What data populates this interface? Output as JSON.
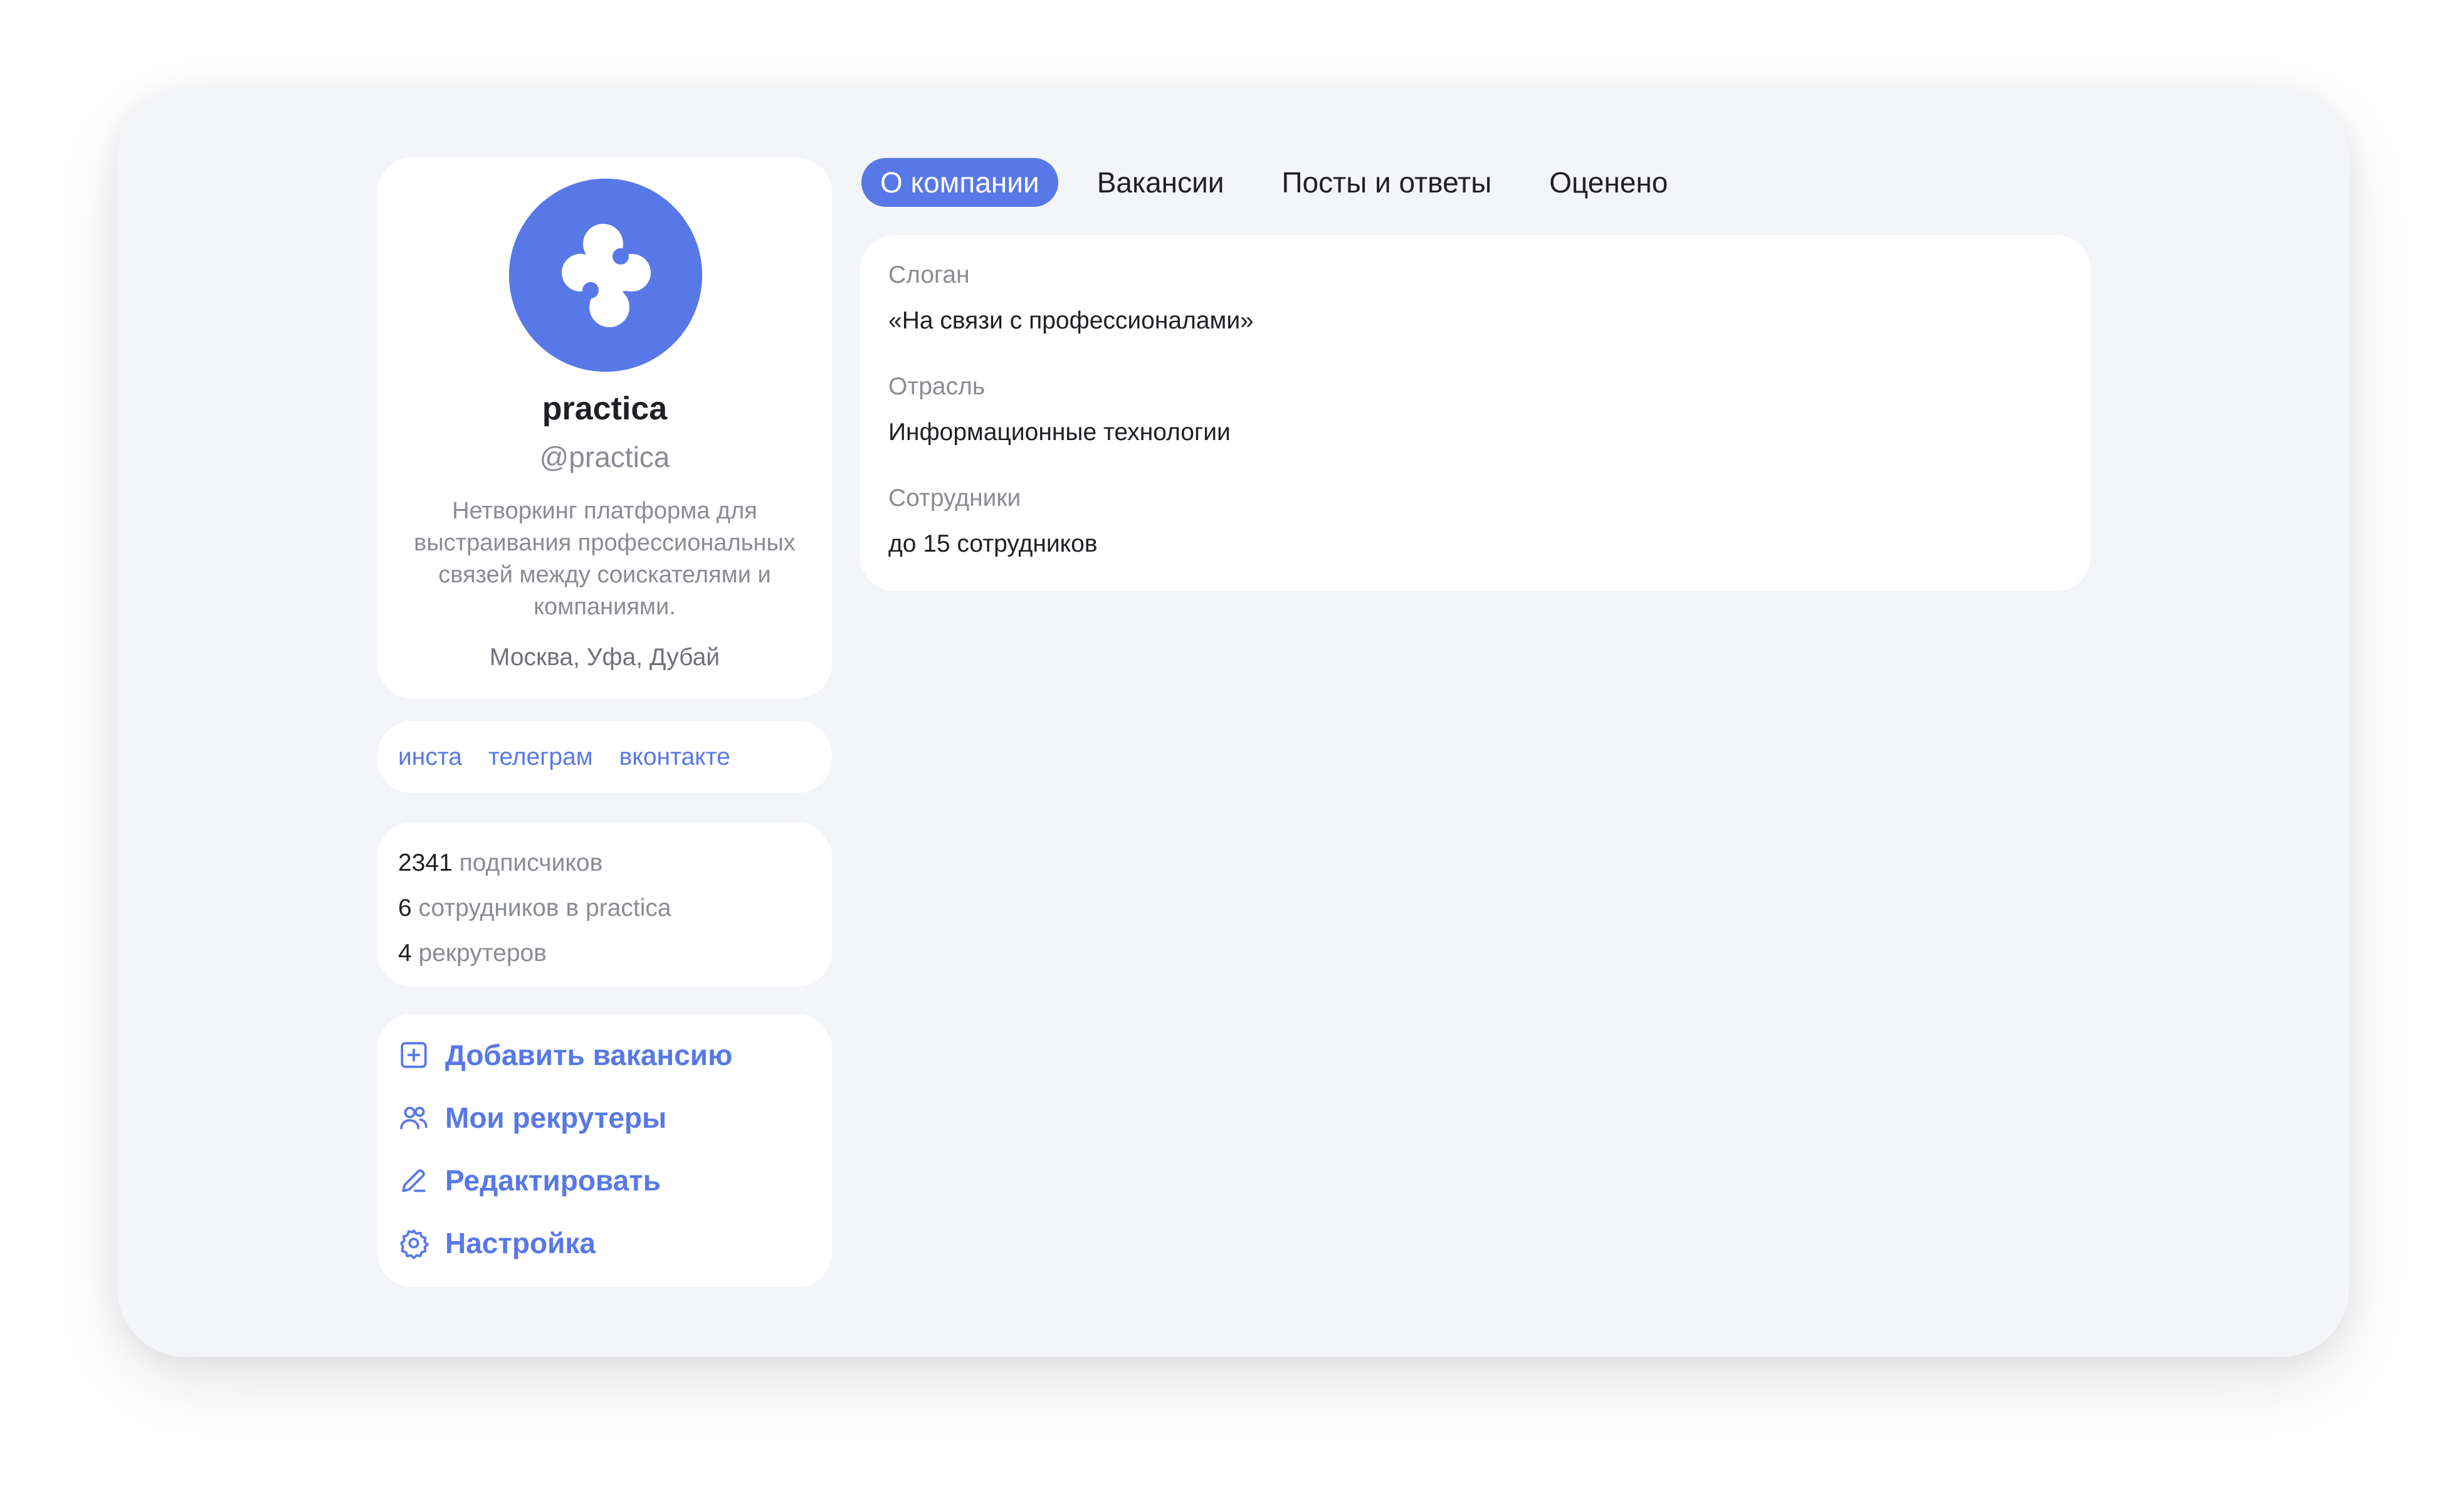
{
  "profile": {
    "name": "practica",
    "handle": "@practica",
    "description": "Нетворкинг платформа для выстраивания профессиональных связей между соискателями и компаниями.",
    "location": "Москва, Уфа, Дубай",
    "logo_icon": "practica-logo-icon",
    "logo_color": "#5878e8"
  },
  "social": {
    "links": [
      "инста",
      "телеграм",
      "вконтакте"
    ]
  },
  "stats": [
    {
      "num": "2341",
      "label": "подписчиков"
    },
    {
      "num": "6",
      "label": "сотрудников в practica"
    },
    {
      "num": "4",
      "label": "рекрутеров"
    }
  ],
  "actions": [
    {
      "label": "Добавить вакансию",
      "icon": "plus-square-icon"
    },
    {
      "label": "Мои рекрутеры",
      "icon": "users-icon"
    },
    {
      "label": "Редактировать",
      "icon": "pencil-icon"
    },
    {
      "label": "Настройка",
      "icon": "gear-icon"
    }
  ],
  "tabs": [
    {
      "label": "О компании",
      "active": true
    },
    {
      "label": "Вакансии",
      "active": false
    },
    {
      "label": "Посты и ответы",
      "active": false
    },
    {
      "label": "Оценено",
      "active": false
    }
  ],
  "about": {
    "slogan_label": "Слоган",
    "slogan_value": "«На связи с профессионалами»",
    "industry_label": "Отрасль",
    "industry_value": "Информационные технологии",
    "employees_label": "Сотрудники",
    "employees_value": "до 15 сотрудников"
  },
  "colors": {
    "accent": "#5878e8",
    "background": "#f4f5f8",
    "card": "#ffffff",
    "text_primary": "#1f1f24",
    "text_secondary": "#8a8c93"
  }
}
